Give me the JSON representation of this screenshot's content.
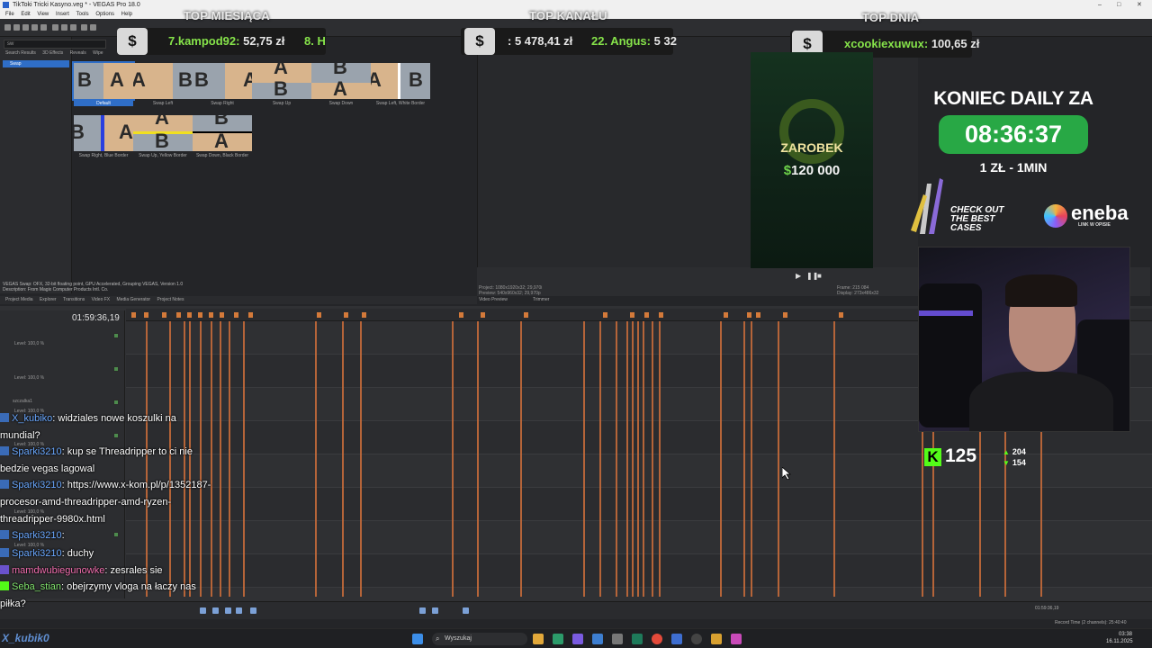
{
  "window": {
    "title": "TikToki Tricki Kasyno.veg * - VEGAS Pro 18.0",
    "controls": {
      "minimize": "–",
      "maximize": "□",
      "close": "✕"
    }
  },
  "menu": [
    "File",
    "Edit",
    "View",
    "Insert",
    "Tools",
    "Options",
    "Help"
  ],
  "explorer": {
    "search_value": "sw",
    "tabs": [
      "Search Results",
      "3D Effects",
      "Reveals",
      "Wipe"
    ],
    "selected_item": "Swap"
  },
  "transitions": [
    {
      "caption": "Default",
      "a": "B",
      "b": "A"
    },
    {
      "caption": "Swap Left",
      "a": "A",
      "b": "B"
    },
    {
      "caption": "Swap Right",
      "a": "B",
      "b": "A"
    },
    {
      "caption": "Swap Up",
      "a": "A",
      "b": "B"
    },
    {
      "caption": "Swap Down",
      "a": "B",
      "b": "A"
    },
    {
      "caption": "Swap Left, White Border",
      "a": "A",
      "b": "B"
    },
    {
      "caption": "Swap Right, Blue Border",
      "a": "B",
      "b": "A"
    },
    {
      "caption": "Swap Up, Yellow Border",
      "a": "A",
      "b": "B"
    },
    {
      "caption": "Swap Down, Black Border",
      "a": "B",
      "b": "A"
    }
  ],
  "info": {
    "line1": "VEGAS Swap: OFX, 32-bit floating point, GPU Accelerated, Grouping VEGAS, Version 1.0",
    "line2": "Description: From Magix Computer Products Intl. Co."
  },
  "bottom_tabs": [
    "Project Media",
    "Explorer",
    "Transitions",
    "Video FX",
    "Media Generator",
    "Project Notes"
  ],
  "preview_tabs": [
    "Video Preview",
    "Trimmer"
  ],
  "preview_info": {
    "project": "Project:  1080x1920x32; 29,970i",
    "preview": "Preview:  540x960x32; 29,970p",
    "frame": "Frame:  215 084",
    "display": "Display:  273x486x32"
  },
  "overlays": {
    "top_month": {
      "heading": "TOP MIESIĄCA",
      "rank": "7.",
      "user": "kampod92:",
      "amount": "52,75 zł",
      "extra": "8. H"
    },
    "top_channel": {
      "heading": "TOP KANAŁU",
      "amount_prefix": ": 5 478,41 zł",
      "rank": "22.",
      "user": "Angus:",
      "amount": "5 32"
    },
    "top_day": {
      "heading": "TOP DNIA",
      "user": "xcookiexuwux:",
      "amount": "100,65 zł"
    },
    "badge_symbol": "$"
  },
  "promo": {
    "title": "ZAROBEK",
    "currency": "$",
    "amount": "120 000"
  },
  "daily": {
    "title": "KONIEC DAILY ZA",
    "timer": "08:36:37",
    "rate": "1 ZŁ - 1MIN"
  },
  "cases": {
    "line1": "CHECK OUT",
    "line2": "THE BEST",
    "line3": "CASES"
  },
  "eneba": {
    "name": "eneba",
    "sub": "LINK W OPISIE"
  },
  "kick": {
    "logo": "K",
    "viewers": "125",
    "stat1": "204",
    "stat2": "154"
  },
  "timeline": {
    "timecode": "01:59:36,19",
    "tracks": [
      {
        "name": "",
        "level": "Level: 100,0 %"
      },
      {
        "name": "",
        "level": "Level: 100,0 %"
      },
      {
        "name": "szczalka1",
        "level": "Level: 100,0 %"
      },
      {
        "name": "",
        "level": "Level: 100,0 %"
      },
      {
        "name": "",
        "level": "Level: 100,0 %"
      },
      {
        "name": "",
        "level": "Level: 100,0 %"
      }
    ]
  },
  "chat": [
    {
      "user": "X_kubiko",
      "user_color": "blue",
      "text": ": widziales nowe koszulki na mundial?"
    },
    {
      "user": "Sparki3210",
      "user_color": "blue",
      "text": ": kup se Threadripper to ci nie bedzie vegas lagowal"
    },
    {
      "user": "Sparki3210",
      "user_color": "blue",
      "text": ": https://www.x-kom.pl/p/1352187-procesor-amd-threadripper-amd-ryzen-threadripper-9980x.html"
    },
    {
      "user": "Sparki3210",
      "user_color": "blue",
      "text": ":"
    },
    {
      "user": "Sparki3210",
      "user_color": "blue",
      "text": ": duchy"
    },
    {
      "user": "mamdwubiegunowke",
      "user_color": "pink",
      "text": ": zesrales sie"
    },
    {
      "user": "Seba_stian",
      "user_color": "green",
      "text": ": obejrzymy vloga na łaczy nas piłka?"
    }
  ],
  "status": {
    "record_time": "Record Time (2 channels): 25:40:40",
    "cursor_time": "01:59:36,19"
  },
  "taskbar": {
    "search": "Wyszukaj",
    "time": "03:38",
    "date": "16.11.2025",
    "streamer": "X_kubik0"
  },
  "colors": {
    "timer_green": "#28a845",
    "kick_green": "#53fc18",
    "cut_orange": "#c46a3a",
    "selection_blue": "#2f6ec7"
  }
}
